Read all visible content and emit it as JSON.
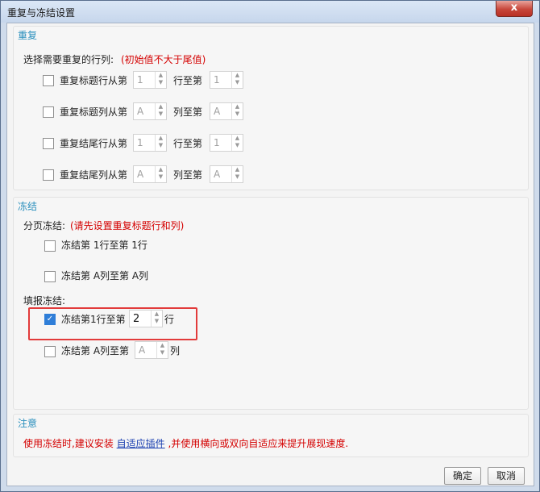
{
  "window": {
    "title": "重复与冻结设置",
    "close_glyph": "x"
  },
  "repeat": {
    "title": "重复",
    "prompt": "选择需要重复的行列:",
    "prompt_note": "(初始值不大于尾值)",
    "rows": [
      {
        "label": "重复标题行从第",
        "from": "1",
        "mid": "行至第",
        "to": "1"
      },
      {
        "label": "重复标题列从第",
        "from": "A",
        "mid": "列至第",
        "to": "A"
      },
      {
        "label": "重复结尾行从第",
        "from": "1",
        "mid": "行至第",
        "to": "1"
      },
      {
        "label": "重复结尾列从第",
        "from": "A",
        "mid": "列至第",
        "to": "A"
      }
    ]
  },
  "freeze": {
    "title": "冻结",
    "page_label": "分页冻结:",
    "page_note": "(请先设置重复标题行和列)",
    "page_rows": [
      "冻结第 1行至第 1行",
      "冻结第 A列至第 A列"
    ],
    "fill_label": "填报冻结:",
    "fill_row1": {
      "label": "冻结第1行至第",
      "value": "2",
      "suffix": "行",
      "checked": true
    },
    "fill_row2": {
      "label": "冻结第 A列至第",
      "value": "A",
      "suffix": "列",
      "checked": false
    }
  },
  "note": {
    "title": "注意",
    "text_before": "使用冻结时,建议安装",
    "link": "自适应插件",
    "text_after": ",并使用横向或双向自适应来提升展现速度."
  },
  "buttons": {
    "ok": "确定",
    "cancel": "取消"
  },
  "colors": {
    "accent_blue": "#2a8fbd",
    "warning_red": "#d40000",
    "highlight_red": "#e23b3b",
    "check_blue": "#2f7ed8"
  },
  "icons": {
    "close": "close-icon",
    "spin": "spinner-arrows-icon",
    "check": "checkmark-icon"
  }
}
